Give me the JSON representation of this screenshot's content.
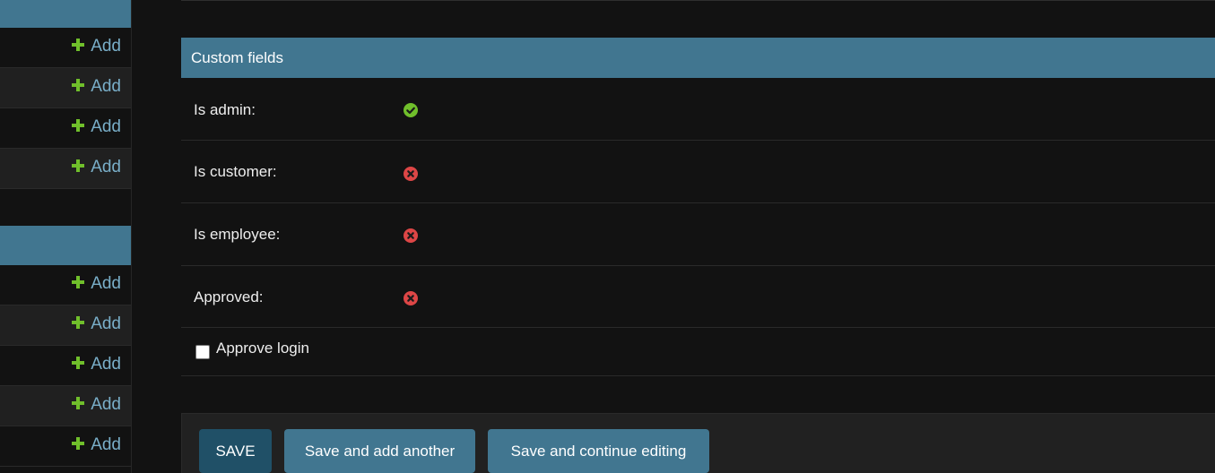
{
  "sidebar": {
    "add_label": "Add"
  },
  "fieldset": {
    "title": "Custom fields",
    "rows": [
      {
        "label": "Is admin:",
        "status": "yes",
        "icon": "check-circle-icon",
        "color": "#70bf2b"
      },
      {
        "label": "Is customer:",
        "status": "no",
        "icon": "x-circle-icon",
        "color": "#dd4646"
      },
      {
        "label": "Is employee:",
        "status": "no",
        "icon": "x-circle-icon",
        "color": "#dd4646"
      },
      {
        "label": "Approved:",
        "status": "no",
        "icon": "x-circle-icon",
        "color": "#dd4646"
      }
    ],
    "checkbox": {
      "label": "Approve login",
      "checked": false
    }
  },
  "submit": {
    "save": "SAVE",
    "save_add_another": "Save and add another",
    "save_continue": "Save and continue editing"
  },
  "colors": {
    "accent": "#417690",
    "primary_button": "#205067",
    "link": "#79aec8",
    "add_plus": "#70bf2b",
    "yes": "#70bf2b",
    "no": "#dd4646"
  }
}
